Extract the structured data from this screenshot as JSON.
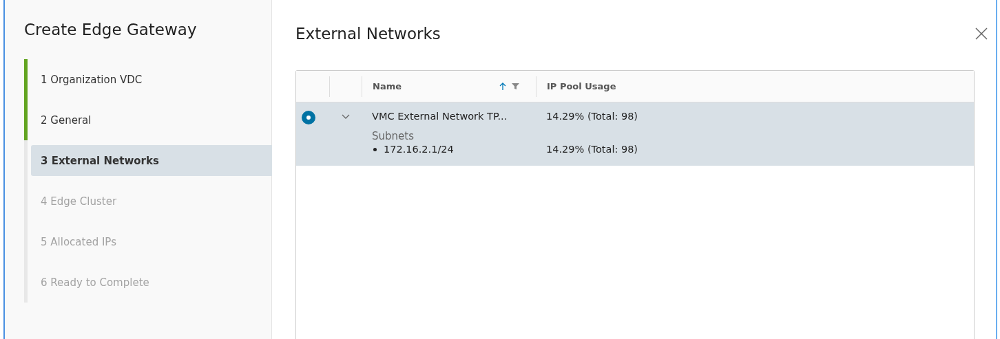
{
  "wizard": {
    "title": "Create Edge Gateway",
    "steps": [
      {
        "label": "1 Organization VDC",
        "completed": true,
        "selected": false,
        "disabled": false
      },
      {
        "label": "2 General",
        "completed": true,
        "selected": false,
        "disabled": false
      },
      {
        "label": "3 External Networks",
        "completed": false,
        "selected": true,
        "disabled": false
      },
      {
        "label": "4 Edge Cluster",
        "completed": false,
        "selected": false,
        "disabled": true
      },
      {
        "label": "5 Allocated IPs",
        "completed": false,
        "selected": false,
        "disabled": true
      },
      {
        "label": "6 Ready to Complete",
        "completed": false,
        "selected": false,
        "disabled": true
      }
    ]
  },
  "page": {
    "title": "External Networks"
  },
  "table": {
    "columns": [
      {
        "label": "Name",
        "sort_ascending": true,
        "filter": true
      },
      {
        "label": "IP Pool Usage"
      }
    ],
    "rows": [
      {
        "selected": true,
        "expanded": true,
        "name": "VMC External Network TP...",
        "usage": "14.29% (Total: 98)",
        "detail_title": "Subnets",
        "subnets": [
          {
            "name": "172.16.2.1/24",
            "usage": "14.29% (Total: 98)"
          }
        ]
      }
    ]
  }
}
